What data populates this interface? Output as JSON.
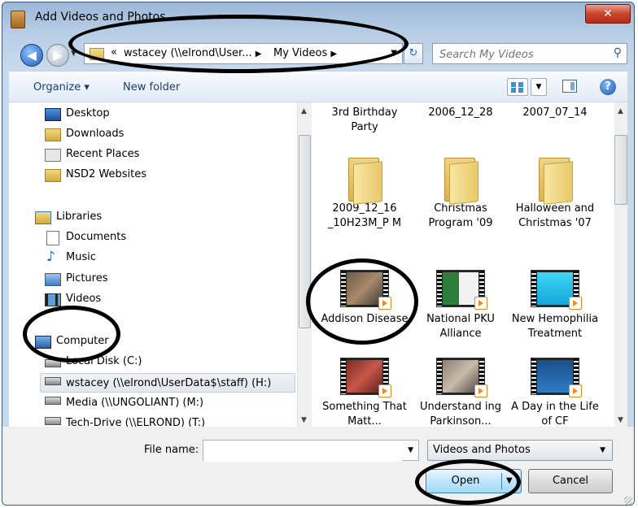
{
  "window": {
    "title": "Add Videos and Photos",
    "close_glyph": "✕"
  },
  "nav": {
    "back_glyph": "◀",
    "forward_glyph": "▶",
    "address_prefix": "«",
    "address_segment1": "wstacey (\\\\elrond\\User...",
    "address_arrow1": "▶",
    "address_segment2": "My Videos",
    "address_arrow2": "▶",
    "refresh_glyph": "↻",
    "search_placeholder": "Search My Videos"
  },
  "toolbar": {
    "organize": "Organize ▾",
    "new_folder": "New folder",
    "views_dd": "▼",
    "help": "?"
  },
  "sidebar": [
    {
      "label": "Desktop",
      "icon": "desktop-icon"
    },
    {
      "label": "Downloads",
      "icon": "downloads-icon"
    },
    {
      "label": "Recent Places",
      "icon": "recent-places-icon"
    },
    {
      "label": "NSD2 Websites",
      "icon": "folder-icon"
    },
    {
      "label": "Libraries",
      "icon": "libraries-icon"
    },
    {
      "label": "Documents",
      "icon": "documents-icon"
    },
    {
      "label": "Music",
      "icon": "music-icon"
    },
    {
      "label": "Pictures",
      "icon": "pictures-icon"
    },
    {
      "label": "Videos",
      "icon": "videos-icon"
    },
    {
      "label": "Computer",
      "icon": "computer-icon"
    },
    {
      "label": "Local Disk (C:)",
      "icon": "disk-icon"
    },
    {
      "label": "wstacey (\\\\elrond\\UserData$\\staff) (H:)",
      "icon": "network-drive-icon",
      "selected": true
    },
    {
      "label": "Media (\\\\UNGOLIANT) (M:)",
      "icon": "network-drive-icon"
    },
    {
      "label": "Tech-Drive (\\\\ELROND) (T:)",
      "icon": "network-drive-icon"
    }
  ],
  "items": [
    {
      "label": "3rd Birthday Party",
      "kind": "folder"
    },
    {
      "label": "2006_12_28",
      "kind": "folder"
    },
    {
      "label": "2007_07_14",
      "kind": "folder"
    },
    {
      "label": "2009_12_16 _10H23M_P M",
      "kind": "folder"
    },
    {
      "label": "Christmas Program '09",
      "kind": "folder"
    },
    {
      "label": "Halloween and Christmas '07",
      "kind": "folder"
    },
    {
      "label": "Addison Disease",
      "kind": "video"
    },
    {
      "label": "National PKU Alliance",
      "kind": "video"
    },
    {
      "label": "New Hemophilia Treatment",
      "kind": "video"
    },
    {
      "label": "Something That Matt...",
      "kind": "video"
    },
    {
      "label": "Understand ing Parkinson...",
      "kind": "video"
    },
    {
      "label": "A Day in the Life of CF",
      "kind": "video"
    }
  ],
  "footer": {
    "file_name_label": "File name:",
    "file_name_value": "",
    "file_type": "Videos and Photos",
    "open_label": "Open",
    "cancel_label": "Cancel",
    "dd_glyph": "▼"
  },
  "colors": {
    "accent": "#3c7fb1",
    "selection": "#e3e7ec",
    "titlebar": "#9cb7d6"
  }
}
